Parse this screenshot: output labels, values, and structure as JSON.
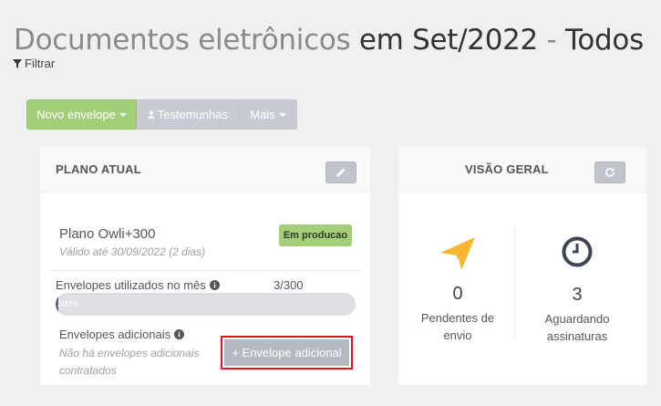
{
  "header": {
    "title_part1": "Documentos eletrônicos",
    "title_part2": "em Set/2022",
    "title_part3": "-",
    "title_part4": "Todos",
    "filter_label": "Filtrar"
  },
  "toolbar": {
    "new_envelope_label": "Novo envelope",
    "witnesses_label": "Testemunhas",
    "more_label": "Mais"
  },
  "plan_card": {
    "title": "PLANO ATUAL",
    "plan_name": "Plano Owli+300",
    "valid_until": "Válido até 30/09/2022 (2 dias)",
    "status_badge": "Em producao",
    "envelopes_used_label": "Envelopes utilizados no mês",
    "envelopes_used_count": "3/300",
    "progress_label": "100%",
    "progress_fraction": 0.01,
    "additional_label": "Envelopes adicionais",
    "additional_note": "Não há envelopes adicionais contratados",
    "add_envelope_button": "+ Envelope adicional"
  },
  "overview_card": {
    "title": "VISÃO GERAL",
    "pending_count": "0",
    "pending_label": "Pendentes de envio",
    "awaiting_count": "3",
    "awaiting_label": "Aguardando assinaturas"
  },
  "colors": {
    "primary_green": "#a3cf7b",
    "button_grey": "#c8cbd2",
    "send_icon_yellow": "#f7b731",
    "clock_icon_dark": "#3d4456",
    "highlight_red": "#e0141e"
  },
  "icons": [
    "filter-icon",
    "user-icon",
    "pencil-icon",
    "refresh-icon",
    "info-icon",
    "paper-plane-icon",
    "clock-icon"
  ]
}
